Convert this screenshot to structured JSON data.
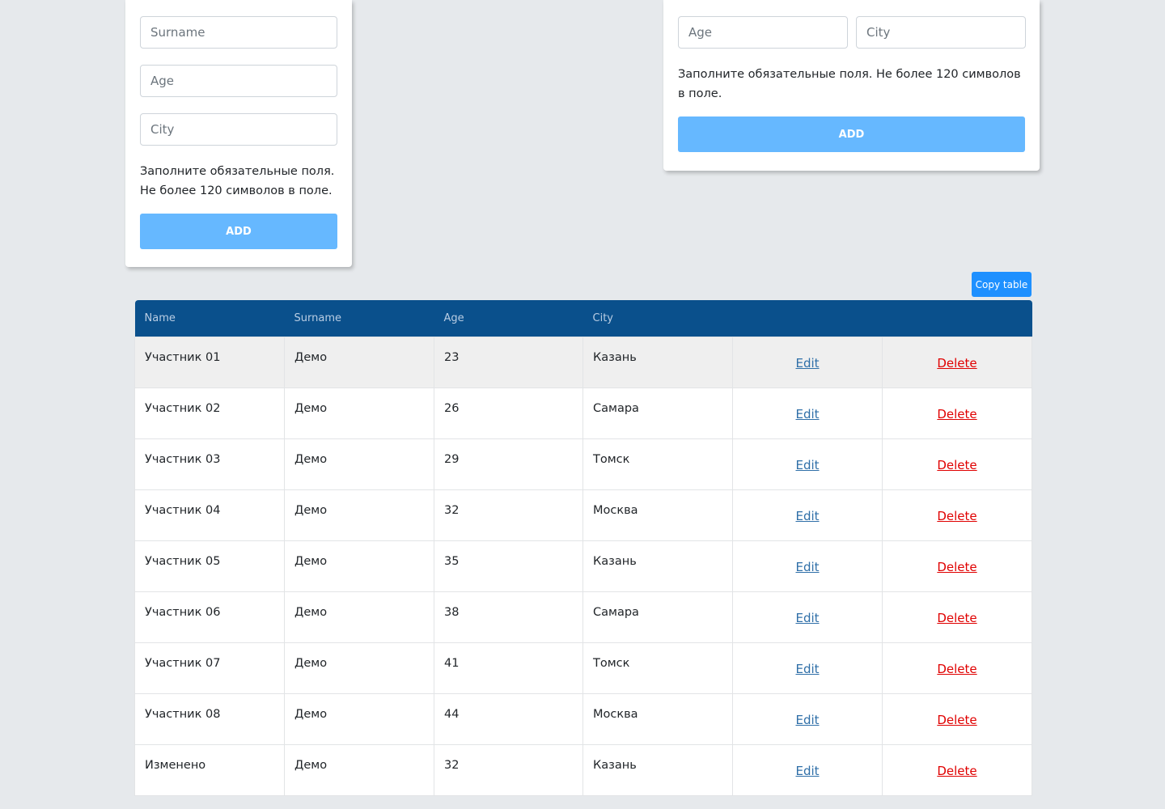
{
  "form_left": {
    "surname_placeholder": "Surname",
    "age_placeholder": "Age",
    "city_placeholder": "City",
    "hint": "Заполните обязательные поля. Не более 120 символов в поле.",
    "add_label": "ADD"
  },
  "form_right": {
    "age_placeholder": "Age",
    "city_placeholder": "City",
    "hint": "Заполните обязательные поля. Не более 120 символов в поле.",
    "add_label": "ADD"
  },
  "copy_table_label": "Copy table",
  "table": {
    "headers": [
      "Name",
      "Surname",
      "Age",
      "City",
      "",
      ""
    ],
    "edit_label": "Edit",
    "delete_label": "Delete",
    "rows": [
      [
        "Участник 01",
        "Демо",
        "23",
        "Казань"
      ],
      [
        "Участник 02",
        "Демо",
        "26",
        "Самара"
      ],
      [
        "Участник 03",
        "Демо",
        "29",
        "Томск"
      ],
      [
        "Участник 04",
        "Демо",
        "32",
        "Москва"
      ],
      [
        "Участник 05",
        "Демо",
        "35",
        "Казань"
      ],
      [
        "Участник 06",
        "Демо",
        "38",
        "Самара"
      ],
      [
        "Участник 07",
        "Демо",
        "41",
        "Томск"
      ],
      [
        "Участник 08",
        "Демо",
        "44",
        "Москва"
      ],
      [
        "Изменено",
        "Демо",
        "32",
        "Казань"
      ]
    ]
  },
  "colors": {
    "background": "#e6e9ec",
    "header": "#0a508c",
    "add_button": "#66b8ff",
    "copy_button": "#1e90ff",
    "edit_link": "#2f6fa8",
    "delete_link": "#e00000"
  }
}
